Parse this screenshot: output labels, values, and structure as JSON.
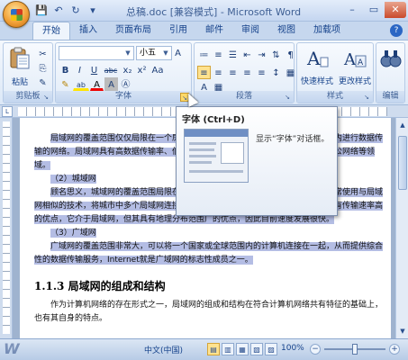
{
  "window": {
    "title": "总稿.doc [兼容模式] - Microsoft Word",
    "qat": [
      "save-icon",
      "undo-icon",
      "redo-icon",
      "dropdown-icon"
    ],
    "controls": [
      "–",
      "▭",
      "✕"
    ]
  },
  "tabs": [
    {
      "label": "开始",
      "active": true
    },
    {
      "label": "插入"
    },
    {
      "label": "页面布局"
    },
    {
      "label": "引用"
    },
    {
      "label": "邮件"
    },
    {
      "label": "审阅"
    },
    {
      "label": "视图"
    },
    {
      "label": "加载项"
    }
  ],
  "help_label": "?",
  "ribbon": {
    "clipboard": {
      "label": "剪贴板",
      "paste_label": "粘贴",
      "small": [
        "✂",
        "⎘",
        "✎"
      ]
    },
    "font": {
      "label": "字体",
      "font_name": "",
      "font_size": "小五",
      "row2": [
        "B",
        "I",
        "U",
        "abc",
        "x₂",
        "x²",
        "Aa"
      ],
      "row3": [
        "✎",
        "ab",
        "A",
        "A",
        "Ⓐ"
      ]
    },
    "paragraph": {
      "label": "段落",
      "row1": [
        "≔",
        "≡",
        "☰",
        "⇤",
        "⇥",
        "⇅",
        "¶"
      ],
      "row2": [
        "≡",
        "≡",
        "≡",
        "≡",
        "≡",
        "↕",
        "▦"
      ]
    },
    "styles": {
      "label": "样式",
      "quick_label": "快速样式",
      "change_label": "更改样式"
    },
    "editing": {
      "label": "编辑"
    }
  },
  "launcher_glyph": "↘",
  "ruler_corner": "L",
  "document": {
    "para1": "局域网的覆盖范围仅仅局限在一个房间、一座楼或者一个单位内，是在较小范围内进行数据传输的网络。局域网具有高数据传输率、低误码率等特点，通常属于一个部门、单位办公网络等领域。",
    "item2": "（2）城域网",
    "para2": "顾名思义，城域网的覆盖范围局限在一个城市范围内，是一种大型的局域网。通常使用与局域网相似的技术，将城市中多个局域网连接起来，其覆盖范围可达几十公里。城域网具有传输速率高的优点，它介于局域网，但其具有地理分布范围广的优点，因此目前速度发展很快。",
    "item3": "（3）广域网",
    "para3": "广域网的覆盖范围非常大，可以将一个国家或全球范围内的计算机连接在一起，从而提供综合性的数据传输服务，Internet就是广域网的标志性成员之一。",
    "heading": "1.1.3  局域网的组成和结构",
    "para4": "作为计算机网络的存在形式之一，局域网的组成和结构在符合计算机网络共有特征的基础上，也有其自身的特点。"
  },
  "tooltip": {
    "title": "字体 (Ctrl+D)",
    "description": "显示“字体”对话框。"
  },
  "scrollbar": {
    "up": "▲",
    "down": "▼"
  },
  "status": {
    "watermark": "W",
    "language": "中文(中国)",
    "views": [
      "▤",
      "▥",
      "▦",
      "▧",
      "▨"
    ],
    "zoom": "100%",
    "zoom_minus": "−",
    "zoom_plus": "+"
  }
}
